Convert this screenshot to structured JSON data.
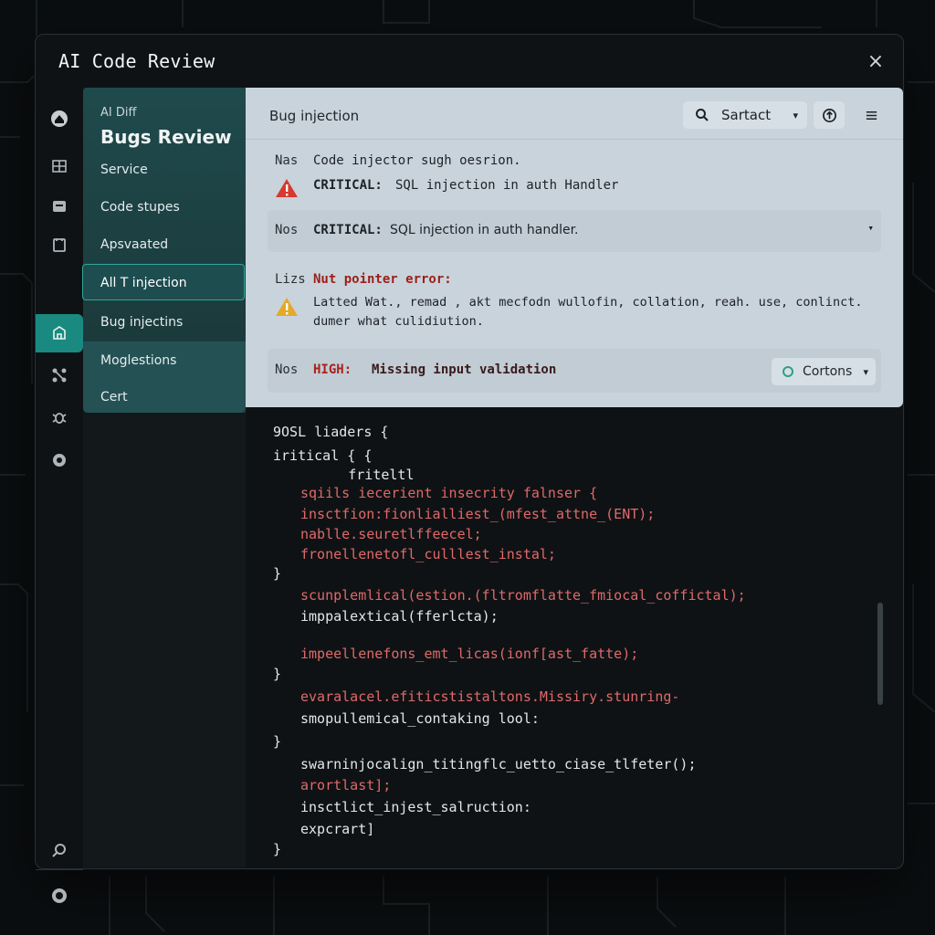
{
  "window": {
    "title": "AI Code Review",
    "close": "×"
  },
  "rail": {
    "icons": [
      "home-icon",
      "layers-icon",
      "inbox-icon",
      "clipboard-icon",
      "building-icon",
      "nodes-icon",
      "bug-icon",
      "gear-icon",
      "search-bug-icon",
      "shield-icon"
    ],
    "active": "building-icon"
  },
  "sidebar": {
    "subtitle": "AI Diff",
    "title": "Bugs Review",
    "items": [
      {
        "label": "Service"
      },
      {
        "label": "Code stupes"
      },
      {
        "label": "Apsvaated"
      },
      {
        "label": "All T injection",
        "active": true
      },
      {
        "label": "Bug injectins"
      },
      {
        "label": "Moglestions"
      },
      {
        "label": "Cert"
      }
    ]
  },
  "panel": {
    "title": "Bug injection",
    "search": {
      "value": "Sartact"
    },
    "findings": [
      {
        "tag": "Nas",
        "text": "Code injector sugh oesrion.",
        "detail_label": "CRITICAL:",
        "detail": "SQL injection in auth Handler"
      },
      {
        "tag": "Nos",
        "label": "CRITICAL:",
        "text": "SQL injection in auth handler."
      },
      {
        "tag": "Lizs",
        "label": "Nut pointer error:",
        "desc1": "Latted Wat., remad , akt mecfodn wullofin, collation, reah. use, conlinct.",
        "desc2": "dumer what culidiution."
      },
      {
        "tag": "Nos",
        "label": "HIGH:",
        "text": "Missing input validation"
      }
    ],
    "filter": {
      "value": "Cortons"
    }
  },
  "code": {
    "lines": [
      "9OSL liaders {",
      "iritical { {",
      "        friteltl",
      "sqiils iecerient insecrity falnser {",
      "insctfion:fionlialliest_(mfest_attne_(ENT);",
      "nablle.seuretlffeecel;",
      "fronellenetofl_culllest_instal;",
      "}",
      "scunplemlical(estion.(fltromflatte_fmiocal_coffictal);",
      "imppalextical(fferlcta);",
      "impeellenefons_emt_licas(ionf[ast_fatte);",
      "}",
      "evaralacel.efiticstistaltons.Missiry.stunring-",
      "smopullemical_contaking lool:",
      "}",
      "swarninjocalign_titingflc_uetto_ciase_tlfeter();",
      "arortlast];",
      "insctlict_injest_salruction:",
      "expcrart]",
      "}"
    ]
  },
  "colors": {
    "accent": "#1a8a80",
    "critical": "#c22a22",
    "panel": "#c9d3dc"
  }
}
